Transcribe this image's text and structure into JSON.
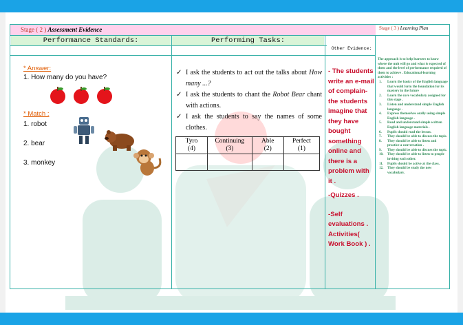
{
  "stage2": {
    "prefix": "Stage",
    "number": "( 2 )",
    "title": "Assessment Evidence"
  },
  "stage3": {
    "prefix": "Stage",
    "number": "( 3 )",
    "title": "Learning Plan"
  },
  "headers": {
    "performance_standards": "Performance Standards:",
    "performing_tasks": "Performing Tasks:",
    "other_evidence": "Other Evidence:"
  },
  "standards": {
    "answer_label": "* Answer:",
    "answer_question": "1. How many do you have?",
    "match_label": "* Match :",
    "match_items": [
      "1. robot",
      "2. bear",
      "3. monkey"
    ]
  },
  "tasks": [
    {
      "check": "✓",
      "text": "I ask the students to act out the talks about",
      "italic": "How many ...?"
    },
    {
      "check": "✓",
      "text": "I ask the students to chant the",
      "italic": "Robot Bear",
      "tail": "chant with actions."
    },
    {
      "check": "✓",
      "text": "I ask the students to say the names of some clothes."
    }
  ],
  "rubric": {
    "headers": [
      {
        "label": "Tyro",
        "score": "(4)"
      },
      {
        "label": "Continuing",
        "score": "(3)"
      },
      {
        "label": "Able",
        "score": "(2)"
      },
      {
        "label": "Perfect",
        "score": "(1)"
      }
    ]
  },
  "other_evidence": {
    "item1": "- The students write an e-mail of complain-the students imagine that they have bought something online and there is a problem with it .",
    "item2": "-Quizzes .",
    "item3": "-Self evaluations . Activities( Work Book ) ."
  },
  "learning_plan": {
    "intro": "The approach is to help learners to know where the unit will go and what is expected of them and the level of performance required of them to achieve . Educational-learning activities :",
    "items": [
      "Learn the basics of the English language that would form the foundation for its mastery in the future",
      "Learn the core vocabulary assigned for this stage .",
      "Listen and understand simple English language .",
      "Express themselves orally using simple English language .",
      "Read and understand simple written English language materials .",
      "Pupils should read the lesson.",
      "They should be able to discuss the topic.",
      "They should be able to listen and practice a conversation .",
      "They should be able to discuss the topic.",
      "They should be able to listen to people inviting each other.",
      "Pupils should be active at the class.",
      "They should be study the new vocabulary."
    ]
  },
  "colors": {
    "band": "#1aa3e6",
    "stage_bg": "#ffd1ec",
    "header_bg": "#d9f4d7",
    "other_text": "#c8102e",
    "plan_text": "#2e8b57",
    "grid": "#38b1a8"
  }
}
